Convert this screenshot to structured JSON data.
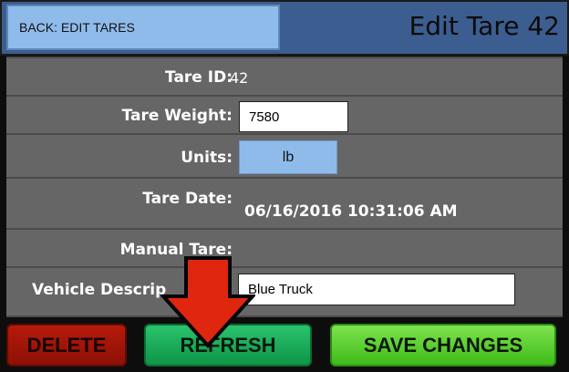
{
  "header": {
    "back_label": "BACK: EDIT TARES",
    "title": "Edit Tare 42"
  },
  "fields": {
    "tare_id": {
      "label": "Tare ID:",
      "value": "42"
    },
    "tare_weight": {
      "label": "Tare Weight:",
      "value": "7580"
    },
    "units": {
      "label": "Units:",
      "value": "lb"
    },
    "tare_date": {
      "label": "Tare Date:",
      "value": "06/16/2016 10:31:06 AM"
    },
    "manual_tare": {
      "label": "Manual Tare:",
      "value": ""
    },
    "vehicle_description": {
      "label": "Vehicle Descrip",
      "value": "Blue Truck"
    }
  },
  "buttons": {
    "delete": "DELETE",
    "refresh": "REFRESH",
    "save": "SAVE CHANGES"
  },
  "colors": {
    "header_bg": "#3c5d8f",
    "back_bg": "#8fbbeb",
    "row_bg": "#666666",
    "delete_bg": "#b41b0b",
    "refresh_bg": "#2bc36d",
    "save_bg": "#7ee34e",
    "arrow": "#e0260e"
  },
  "icons": {
    "annotation": "red-down-arrow-icon"
  }
}
